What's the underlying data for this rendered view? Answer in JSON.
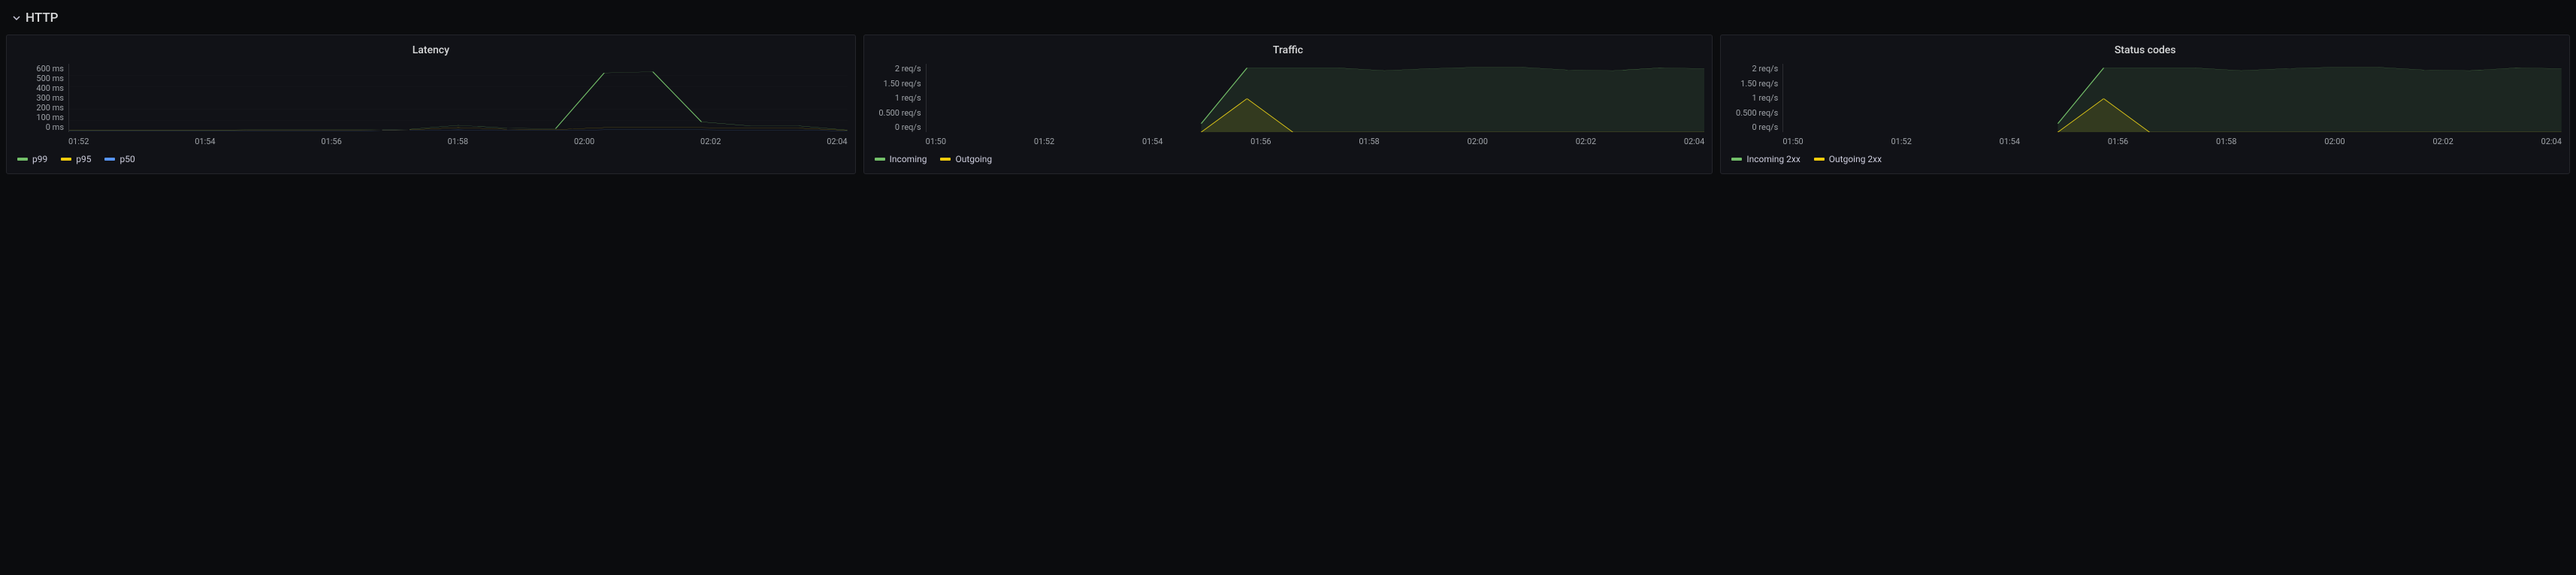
{
  "section": {
    "title": "HTTP"
  },
  "colors": {
    "green": "#73bf69",
    "yellow": "#f2cc0c",
    "blue": "#5794f2",
    "grid": "#2c2d32"
  },
  "panels": [
    {
      "id": "latency",
      "title": "Latency",
      "legend": [
        {
          "name": "p99",
          "color": "#73bf69"
        },
        {
          "name": "p95",
          "color": "#f2cc0c"
        },
        {
          "name": "p50",
          "color": "#5794f2"
        }
      ]
    },
    {
      "id": "traffic",
      "title": "Traffic",
      "legend": [
        {
          "name": "Incoming",
          "color": "#73bf69"
        },
        {
          "name": "Outgoing",
          "color": "#f2cc0c"
        }
      ]
    },
    {
      "id": "status",
      "title": "Status codes",
      "legend": [
        {
          "name": "Incoming 2xx",
          "color": "#73bf69"
        },
        {
          "name": "Outgoing 2xx",
          "color": "#f2cc0c"
        }
      ]
    }
  ],
  "chart_data": [
    {
      "type": "line",
      "title": "Latency",
      "xlabel": "",
      "ylabel": "",
      "ylim": [
        0,
        600
      ],
      "y_ticks": [
        "600 ms",
        "500 ms",
        "400 ms",
        "300 ms",
        "200 ms",
        "100 ms",
        "0 ms"
      ],
      "x_ticks": [
        "01:52",
        "01:54",
        "01:56",
        "01:58",
        "02:00",
        "02:02",
        "02:04"
      ],
      "x": [
        "01:51",
        "01:52",
        "01:53",
        "01:54",
        "01:55",
        "01:56",
        "01:57",
        "01:58",
        "01:59",
        "02:00",
        "02:01",
        "02:01.5",
        "02:02",
        "02:02.5",
        "02:03",
        "02:04",
        "02:05"
      ],
      "series": [
        {
          "name": "p99",
          "color": "#73bf69",
          "values": [
            18,
            18,
            18,
            18,
            22,
            22,
            22,
            25,
            60,
            35,
            30,
            520,
            530,
            90,
            55,
            55,
            18
          ]
        },
        {
          "name": "p95",
          "color": "#f2cc0c",
          "values": [
            15,
            15,
            15,
            15,
            18,
            18,
            18,
            20,
            40,
            25,
            22,
            40,
            40,
            40,
            35,
            35,
            15
          ]
        },
        {
          "name": "p50",
          "color": "#5794f2",
          "values": [
            10,
            10,
            10,
            10,
            12,
            12,
            12,
            15,
            20,
            15,
            15,
            20,
            20,
            20,
            18,
            18,
            10
          ]
        }
      ]
    },
    {
      "type": "area",
      "title": "Traffic",
      "xlabel": "",
      "ylabel": "",
      "ylim": [
        0,
        2
      ],
      "y_ticks": [
        "2 req/s",
        "1.50 req/s",
        "1 req/s",
        "0.500 req/s",
        "0 req/s"
      ],
      "x_ticks": [
        "01:50",
        "01:52",
        "01:54",
        "01:56",
        "01:58",
        "02:00",
        "02:02",
        "02:04"
      ],
      "x": [
        "01:50",
        "01:51",
        "01:52",
        "01:53",
        "01:54",
        "01:55",
        "01:55.5",
        "01:56",
        "01:56.5",
        "01:57",
        "01:58",
        "01:59",
        "02:00",
        "02:01",
        "02:02",
        "02:03",
        "02:04",
        "02:05"
      ],
      "series": [
        {
          "name": "Incoming",
          "color": "#73bf69",
          "values": [
            null,
            null,
            null,
            null,
            null,
            null,
            0.25,
            1.88,
            1.88,
            1.88,
            1.8,
            1.86,
            1.9,
            1.9,
            1.82,
            1.8,
            1.88,
            1.86
          ]
        },
        {
          "name": "Outgoing",
          "color": "#f2cc0c",
          "values": [
            null,
            null,
            null,
            null,
            null,
            null,
            0.0,
            0.98,
            0.0,
            0.0,
            0.0,
            0.0,
            0.0,
            0.0,
            0.0,
            0.0,
            0.0,
            0.0
          ]
        }
      ]
    },
    {
      "type": "area",
      "title": "Status codes",
      "xlabel": "",
      "ylabel": "",
      "ylim": [
        0,
        2
      ],
      "y_ticks": [
        "2 req/s",
        "1.50 req/s",
        "1 req/s",
        "0.500 req/s",
        "0 req/s"
      ],
      "x_ticks": [
        "01:50",
        "01:52",
        "01:54",
        "01:56",
        "01:58",
        "02:00",
        "02:02",
        "02:04"
      ],
      "x": [
        "01:50",
        "01:51",
        "01:52",
        "01:53",
        "01:54",
        "01:55",
        "01:55.5",
        "01:56",
        "01:56.5",
        "01:57",
        "01:58",
        "01:59",
        "02:00",
        "02:01",
        "02:02",
        "02:03",
        "02:04",
        "02:05"
      ],
      "series": [
        {
          "name": "Incoming 2xx",
          "color": "#73bf69",
          "values": [
            null,
            null,
            null,
            null,
            null,
            null,
            0.25,
            1.88,
            1.88,
            1.88,
            1.8,
            1.86,
            1.9,
            1.9,
            1.82,
            1.8,
            1.88,
            1.86
          ]
        },
        {
          "name": "Outgoing 2xx",
          "color": "#f2cc0c",
          "values": [
            null,
            null,
            null,
            null,
            null,
            null,
            0.0,
            0.98,
            0.0,
            0.0,
            0.0,
            0.0,
            0.0,
            0.0,
            0.0,
            0.0,
            0.0,
            0.0
          ]
        }
      ]
    }
  ]
}
